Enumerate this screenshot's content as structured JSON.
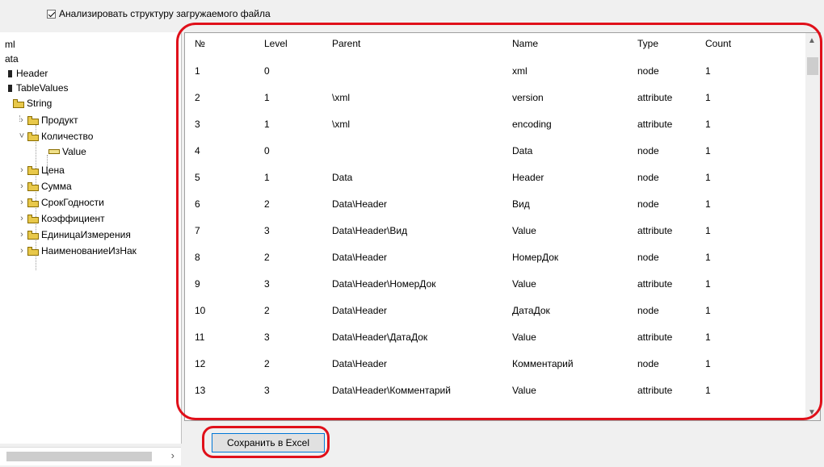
{
  "options": {
    "analyze_label": "Анализировать структуру загружаемого файла"
  },
  "tree": {
    "nodes": [
      "ml",
      "ata",
      "Header",
      "TableValues",
      "String",
      "Продукт",
      "Количество",
      "Value",
      "Цена",
      "Сумма",
      "СрокГодности",
      "Коэффициент",
      "ЕдиницаИзмерения",
      "НаименованиеИзНак"
    ]
  },
  "grid": {
    "headers": [
      "№",
      "Level",
      "Parent",
      "Name",
      "Type",
      "Count"
    ],
    "rows": [
      [
        "1",
        "0",
        "",
        "xml",
        "node",
        "1"
      ],
      [
        "2",
        "1",
        "\\xml",
        "version",
        "attribute",
        "1"
      ],
      [
        "3",
        "1",
        "\\xml",
        "encoding",
        "attribute",
        "1"
      ],
      [
        "4",
        "0",
        "",
        "Data",
        "node",
        "1"
      ],
      [
        "5",
        "1",
        "Data",
        "Header",
        "node",
        "1"
      ],
      [
        "6",
        "2",
        "Data\\Header",
        "Вид",
        "node",
        "1"
      ],
      [
        "7",
        "3",
        "Data\\Header\\Вид",
        "Value",
        "attribute",
        "1"
      ],
      [
        "8",
        "2",
        "Data\\Header",
        "НомерДок",
        "node",
        "1"
      ],
      [
        "9",
        "3",
        "Data\\Header\\НомерДок",
        "Value",
        "attribute",
        "1"
      ],
      [
        "10",
        "2",
        "Data\\Header",
        "ДатаДок",
        "node",
        "1"
      ],
      [
        "11",
        "3",
        "Data\\Header\\ДатаДок",
        "Value",
        "attribute",
        "1"
      ],
      [
        "12",
        "2",
        "Data\\Header",
        "Комментарий",
        "node",
        "1"
      ],
      [
        "13",
        "3",
        "Data\\Header\\Комментарий",
        "Value",
        "attribute",
        "1"
      ]
    ]
  },
  "buttons": {
    "save_excel": "Сохранить в Excel"
  },
  "colors": {
    "highlight": "#e0101a",
    "focus": "#0078d7",
    "folder": "#e8c84a"
  },
  "icons": {
    "folder": "folder-icon",
    "leaf": "leaf-icon",
    "expand": "chevron-right-icon",
    "collapse": "chevron-down-icon"
  }
}
